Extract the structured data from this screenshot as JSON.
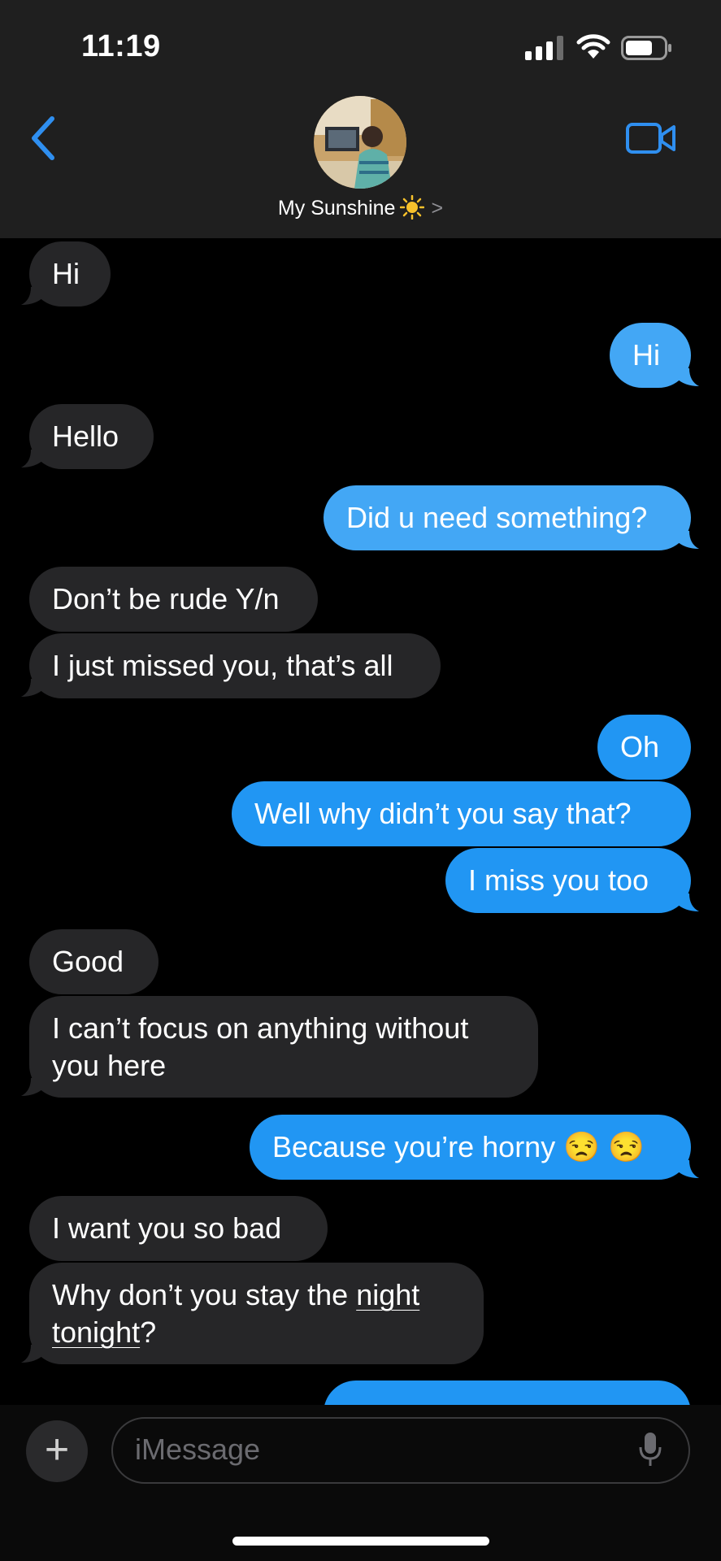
{
  "status_bar": {
    "time": "11:19"
  },
  "header": {
    "contact_name": "My Sunshine"
  },
  "messages": [
    {
      "dir": "in",
      "text": "Hi"
    },
    {
      "dir": "out",
      "text": "Hi"
    },
    {
      "dir": "in",
      "text": "Hello"
    },
    {
      "dir": "out",
      "text": "Did u need something?"
    },
    {
      "dir": "in",
      "text": "Don’t be rude Y/n"
    },
    {
      "dir": "in",
      "text": "I just missed you, that’s all"
    },
    {
      "dir": "out",
      "text": "Oh"
    },
    {
      "dir": "out",
      "text": "Well why didn’t you say that?"
    },
    {
      "dir": "out",
      "text": "I miss you too"
    },
    {
      "dir": "in",
      "text": "Good"
    },
    {
      "dir": "in",
      "line1": "I can’t focus on anything without",
      "line2": "you here"
    },
    {
      "dir": "out",
      "text": "Because you’re horny",
      "emoji": "😒 😒"
    },
    {
      "dir": "in",
      "text": "I want you so bad"
    },
    {
      "dir": "in",
      "line1_a": "Why don’t you stay the ",
      "line1_b": "night",
      "line2_a": "tonight",
      "line2_b": "?"
    }
  ],
  "composer": {
    "placeholder": "iMessage",
    "plus": "+"
  }
}
